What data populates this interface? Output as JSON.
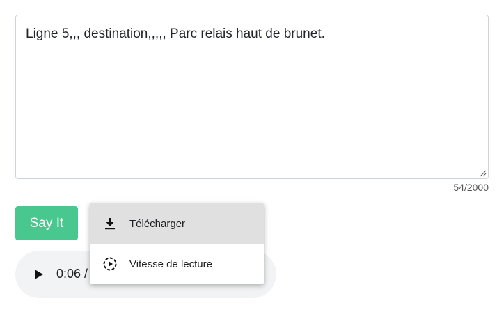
{
  "textarea": {
    "value": "Ligne 5,,, destination,,,,, Parc relais haut de brunet.",
    "char_count": "54/2000"
  },
  "say_button": {
    "label": "Say It",
    "color": "#48c78e"
  },
  "audio_player": {
    "time": "0:06 /",
    "play_icon": "play-icon"
  },
  "context_menu": {
    "items": [
      {
        "label": "Télécharger",
        "icon": "download-icon"
      },
      {
        "label": "Vitesse de lecture",
        "icon": "playback-speed-icon"
      }
    ]
  }
}
